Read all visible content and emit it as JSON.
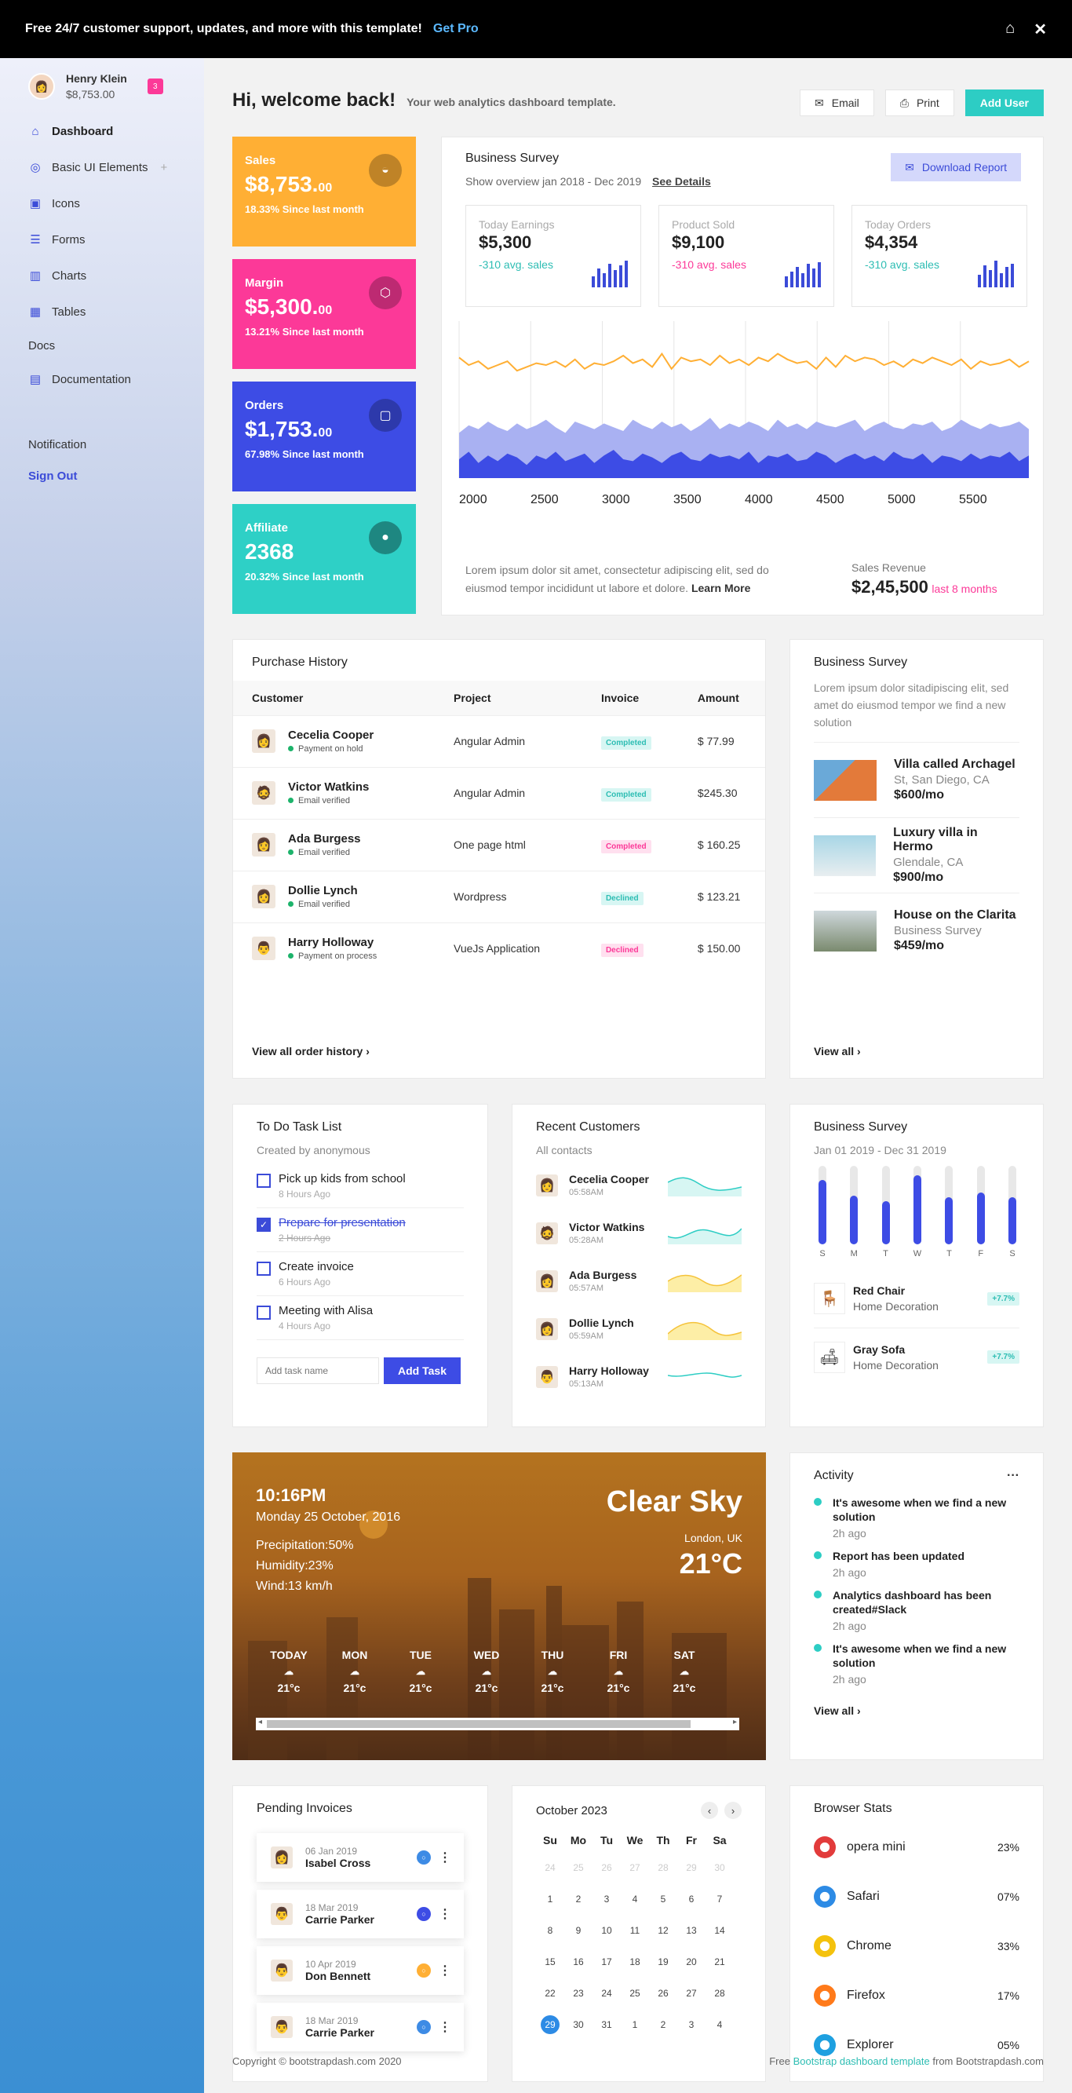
{
  "topbar": {
    "message": "Free 24/7 customer support, updates, and more with this template!",
    "cta": "Get Pro"
  },
  "user": {
    "name": "Henry Klein",
    "balance": "$8,753.00",
    "badge": "3"
  },
  "sidebar": {
    "items": [
      {
        "label": "Dashboard",
        "icon": "home-icon"
      },
      {
        "label": "Basic UI Elements",
        "icon": "crosshair-icon"
      },
      {
        "label": "Icons",
        "icon": "contacts-icon"
      },
      {
        "label": "Forms",
        "icon": "list-icon"
      },
      {
        "label": "Charts",
        "icon": "chart-icon"
      },
      {
        "label": "Tables",
        "icon": "table-icon"
      }
    ],
    "docs_label": "Docs",
    "documentation": "Documentation",
    "notification": "Notification",
    "signout": "Sign Out"
  },
  "header": {
    "title": "Hi, welcome back!",
    "subtitle": "Your web analytics dashboard template.",
    "email": "Email",
    "print": "Print",
    "add_user": "Add User"
  },
  "stats": [
    {
      "title": "Sales",
      "value": "$8,753.",
      "cents": "00",
      "sub": "18.33% Since last month",
      "color": "#ffaf34",
      "icon": "basket-icon"
    },
    {
      "title": "Margin",
      "value": "$5,300.",
      "cents": "00",
      "sub": "13.21% Since last month",
      "color": "#fc3998",
      "icon": "cube-icon"
    },
    {
      "title": "Orders",
      "value": "$1,753.",
      "cents": "00",
      "sub": "67.98% Since last month",
      "color": "#3d4ce5",
      "icon": "briefcase-icon"
    },
    {
      "title": "Affiliate",
      "value": "2368",
      "cents": "",
      "sub": "20.32% Since last month",
      "color": "#2ed0c6",
      "icon": "user-circle-icon"
    }
  ],
  "survey": {
    "title": "Business Survey",
    "overview": "Show overview jan 2018 - Dec 2019",
    "details": "See Details",
    "download": "Download Report",
    "minis": [
      {
        "label": "Today Earnings",
        "value": "$5,300",
        "avg": "-310 avg. sales",
        "color": "#2dbdb3"
      },
      {
        "label": "Product Sold",
        "value": "$9,100",
        "avg": "-310 avg. sales",
        "color": "#fc3998"
      },
      {
        "label": "Today Orders",
        "value": "$4,354",
        "avg": "-310 avg. sales",
        "color": "#2dbdb3"
      }
    ],
    "desc": "Lorem ipsum dolor sit amet, consectetur adipiscing elit, sed do eiusmod tempor incididunt ut labore et dolore.",
    "learn": "Learn More",
    "rev_label": "Sales Revenue",
    "rev_value": "$2,45,500",
    "rev_period": "last 8 months"
  },
  "chart_data": {
    "type": "line",
    "x_ticks": [
      "2000",
      "2500",
      "3000",
      "3500",
      "4000",
      "4500",
      "5000",
      "5500"
    ],
    "series": [
      {
        "color": "#ffaf34",
        "values": [
          64,
          60,
          62,
          58,
          60,
          62,
          57,
          59,
          61,
          60,
          62,
          59,
          63,
          58,
          61,
          60,
          62,
          65,
          61,
          63,
          59,
          66,
          58,
          64,
          62,
          63,
          60,
          65,
          61,
          63,
          60,
          64,
          62,
          66,
          63,
          61,
          62,
          58,
          64,
          59,
          65,
          62,
          64,
          63,
          60,
          62,
          59,
          63,
          61,
          64,
          62,
          60,
          63,
          58,
          62,
          60,
          61,
          63,
          59,
          62
        ]
      },
      {
        "color": "#a9b1f2",
        "values": [
          18,
          22,
          20,
          24,
          21,
          19,
          23,
          20,
          22,
          25,
          21,
          18,
          24,
          22,
          20,
          23,
          21,
          19,
          25,
          22,
          20,
          24,
          21,
          23,
          19,
          22,
          26,
          20,
          23,
          21,
          24,
          22,
          19,
          25,
          21,
          23,
          20,
          24,
          22,
          21,
          23,
          25,
          19,
          22,
          24,
          21,
          20,
          23,
          22,
          24,
          19,
          21,
          25,
          22,
          20,
          23,
          21,
          22,
          24,
          20
        ]
      },
      {
        "color": "#3d4ce5",
        "values": [
          10,
          14,
          8,
          12,
          9,
          13,
          11,
          7,
          12,
          10,
          14,
          9,
          11,
          13,
          8,
          12,
          15,
          10,
          9,
          13,
          11,
          8,
          12,
          14,
          10,
          9,
          13,
          11,
          12,
          10,
          14,
          8,
          12,
          11,
          13,
          9,
          10,
          14,
          12,
          8,
          11,
          13,
          10,
          12,
          9,
          14,
          11,
          10,
          13,
          8,
          12,
          11,
          9,
          13,
          10,
          12,
          11,
          14,
          9,
          12
        ]
      }
    ]
  },
  "purchase": {
    "title": "Purchase History",
    "headers": [
      "Customer",
      "Project",
      "Invoice",
      "Amount"
    ],
    "rows": [
      {
        "name": "Cecelia Cooper",
        "status": "Payment on hold",
        "project": "Angular Admin",
        "invoice": "Completed",
        "amount": "$ 77.99",
        "pill": "g"
      },
      {
        "name": "Victor Watkins",
        "status": "Email verified",
        "project": "Angular Admin",
        "invoice": "Completed",
        "amount": "$245.30",
        "pill": "g"
      },
      {
        "name": "Ada Burgess",
        "status": "Email verified",
        "project": "One page html",
        "invoice": "Completed",
        "amount": "$ 160.25",
        "pill": "p"
      },
      {
        "name": "Dollie Lynch",
        "status": "Email verified",
        "project": "Wordpress",
        "invoice": "Declined",
        "amount": "$ 123.21",
        "pill": "g"
      },
      {
        "name": "Harry Holloway",
        "status": "Payment on process",
        "project": "VueJs Application",
        "invoice": "Declined",
        "amount": "$ 150.00",
        "pill": "p"
      }
    ],
    "view_all": "View all order history"
  },
  "survey2": {
    "title": "Business Survey",
    "desc": "Lorem ipsum dolor sitadipiscing elit, sed amet do eiusmod tempor we find a new solution",
    "props": [
      {
        "title": "Villa called Archagel",
        "loc": "St, San Diego, CA",
        "price": "$600/mo"
      },
      {
        "title": "Luxury villa in Hermo",
        "loc": "Glendale, CA",
        "price": "$900/mo"
      },
      {
        "title": "House on the Clarita",
        "loc": "Business Survey",
        "price": "$459/mo"
      }
    ],
    "view_all": "View all"
  },
  "todo": {
    "title": "To Do Task List",
    "sub": "Created by anonymous",
    "tasks": [
      {
        "t": "Pick up kids from school",
        "m": "8 Hours Ago",
        "done": false
      },
      {
        "t": "Prepare for presentation",
        "m": "2 Hours Ago",
        "done": true
      },
      {
        "t": "Create invoice",
        "m": "6 Hours Ago",
        "done": false
      },
      {
        "t": "Meeting with Alisa",
        "m": "4 Hours Ago",
        "done": false
      }
    ],
    "placeholder": "Add task name",
    "add": "Add Task"
  },
  "recent": {
    "title": "Recent Customers",
    "sub": "All contacts",
    "items": [
      {
        "n": "Cecelia Cooper",
        "t": "05:58AM",
        "c": "#2dcdc4",
        "f": "#d7f6f3"
      },
      {
        "n": "Victor Watkins",
        "t": "05:28AM",
        "c": "#2dcdc4",
        "f": "#d7f6f3"
      },
      {
        "n": "Ada Burgess",
        "t": "05:57AM",
        "c": "#f5c33b",
        "f": "#fdeea6"
      },
      {
        "n": "Dollie Lynch",
        "t": "05:59AM",
        "c": "#f5c33b",
        "f": "#fdeea6"
      },
      {
        "n": "Harry Holloway",
        "t": "05:13AM",
        "c": "#2dcdc4",
        "f": "#ffffff"
      }
    ]
  },
  "survey3": {
    "title": "Business Survey",
    "range": "Jan 01 2019 - Dec 31 2019",
    "days": [
      "S",
      "M",
      "T",
      "W",
      "T",
      "F",
      "S"
    ],
    "levels": [
      0.82,
      0.62,
      0.55,
      0.88,
      0.6,
      0.66,
      0.6
    ],
    "items": [
      {
        "name": "Red Chair",
        "cat": "Home Decoration",
        "badge": "+7.7%"
      },
      {
        "name": "Gray Sofa",
        "cat": "Home Decoration",
        "badge": "+7.7%"
      }
    ]
  },
  "weather": {
    "time": "10:16PM",
    "date": "Monday 25 October, 2016",
    "precip": "Precipitation:50%",
    "humidity": "Humidity:23%",
    "wind": "Wind:13 km/h",
    "condition": "Clear Sky",
    "location": "London, UK",
    "temp": "21°C",
    "days": [
      {
        "d": "TODAY",
        "t": "21°c"
      },
      {
        "d": "MON",
        "t": "21°c"
      },
      {
        "d": "TUE",
        "t": "21°c"
      },
      {
        "d": "WED",
        "t": "21°c"
      },
      {
        "d": "THU",
        "t": "21°c"
      },
      {
        "d": "FRI",
        "t": "21°c"
      },
      {
        "d": "SAT",
        "t": "21°c"
      }
    ]
  },
  "activity": {
    "title": "Activity",
    "items": [
      {
        "t": "It's awesome when we find a new solution",
        "d": "2h ago"
      },
      {
        "t": "Report has been updated",
        "d": "2h ago"
      },
      {
        "t": "Analytics dashboard has been created#Slack",
        "d": "2h ago"
      },
      {
        "t": "It's awesome when we find a new solution",
        "d": "2h ago"
      }
    ],
    "view_all": "View all"
  },
  "invoices": {
    "title": "Pending Invoices",
    "items": [
      {
        "date": "06 Jan 2019",
        "name": "Isabel Cross",
        "c": "#3d8be5"
      },
      {
        "date": "18 Mar 2019",
        "name": "Carrie Parker",
        "c": "#3d4ce5"
      },
      {
        "date": "10 Apr 2019",
        "name": "Don Bennett",
        "c": "#ffaf34"
      },
      {
        "date": "18 Mar 2019",
        "name": "Carrie Parker",
        "c": "#3d8be5"
      }
    ]
  },
  "calendar": {
    "title": "October 2023",
    "days": [
      "Su",
      "Mo",
      "Tu",
      "We",
      "Th",
      "Fr",
      "Sa"
    ],
    "weeks": [
      [
        "24",
        "25",
        "26",
        "27",
        "28",
        "29",
        "30"
      ],
      [
        "1",
        "2",
        "3",
        "4",
        "5",
        "6",
        "7"
      ],
      [
        "8",
        "9",
        "10",
        "11",
        "12",
        "13",
        "14"
      ],
      [
        "15",
        "16",
        "17",
        "18",
        "19",
        "20",
        "21"
      ],
      [
        "22",
        "23",
        "24",
        "25",
        "26",
        "27",
        "28"
      ],
      [
        "29",
        "30",
        "31",
        "1",
        "2",
        "3",
        "4"
      ]
    ]
  },
  "browsers": {
    "title": "Browser Stats",
    "items": [
      {
        "n": "opera mini",
        "p": "23%",
        "c": "#e23b3b"
      },
      {
        "n": "Safari",
        "p": "07%",
        "c": "#2d8be5"
      },
      {
        "n": "Chrome",
        "p": "33%",
        "c": "#f4c20d"
      },
      {
        "n": "Firefox",
        "p": "17%",
        "c": "#ff7a1a"
      },
      {
        "n": "Explorer",
        "p": "05%",
        "c": "#1ea0e0"
      }
    ]
  },
  "footer": {
    "copy": "Copyright © bootstrapdash.com 2020",
    "free": "Free",
    "link": "Bootstrap dashboard template",
    "from": "from Bootstrapdash.com"
  }
}
